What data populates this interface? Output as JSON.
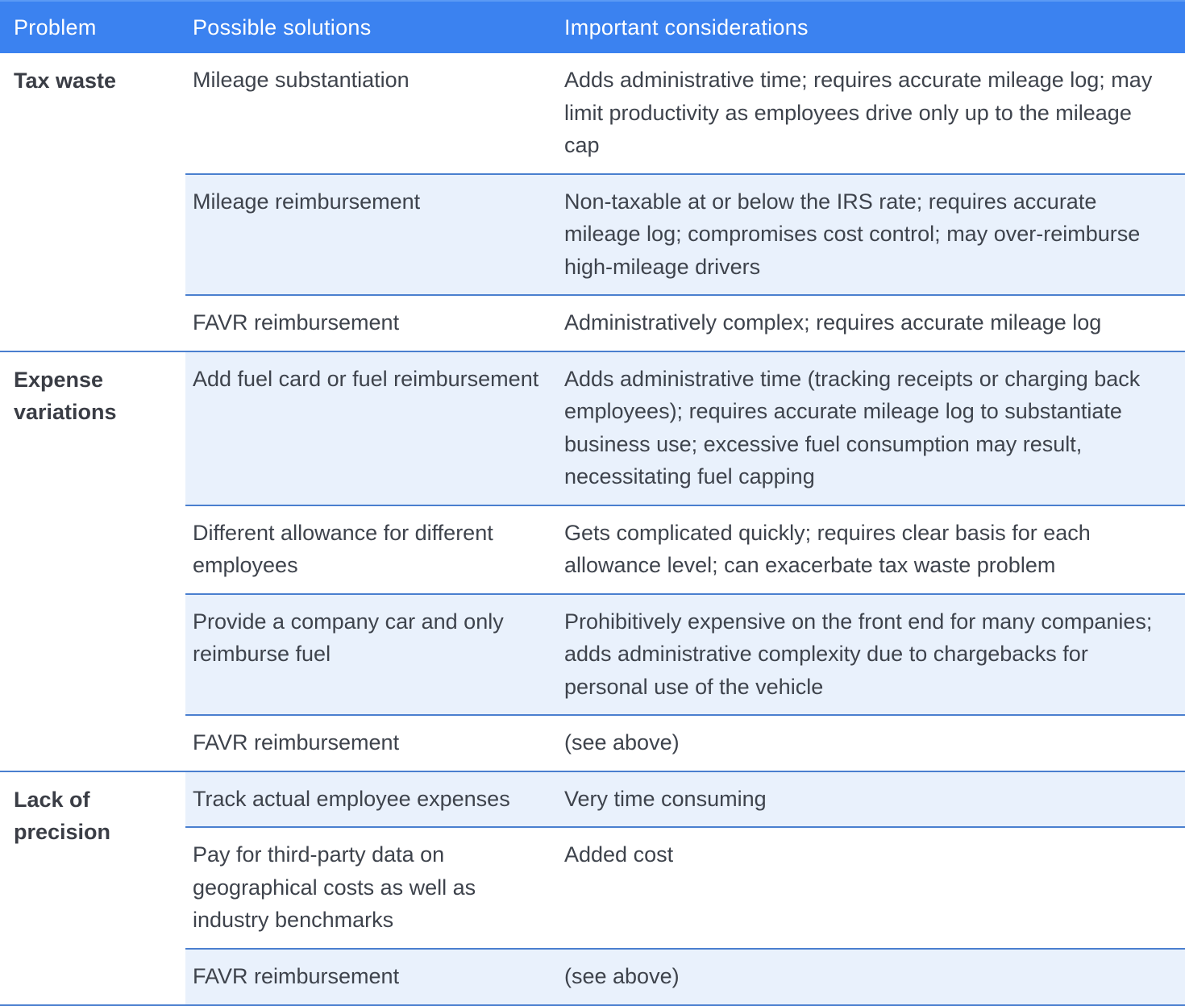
{
  "header": {
    "problem": "Problem",
    "solutions": "Possible solutions",
    "considerations": "Important considerations"
  },
  "colors": {
    "header_bg": "#3b82f0",
    "row_shade": "#e9f1fc",
    "divider": "#4a7fcf"
  },
  "groups": [
    {
      "problem": "Tax waste",
      "rows": [
        {
          "solution": "Mileage substantiation",
          "consideration": "Adds administrative time; requires accurate mileage log; may limit productivity as employees drive only up to the mileage cap"
        },
        {
          "solution": "Mileage reimbursement",
          "consideration": "Non-taxable at or below the IRS rate; requires accurate mileage log; compromises cost control; may over-reimburse high-mileage drivers"
        },
        {
          "solution": "FAVR reimbursement",
          "consideration": "Administratively complex; requires accurate mileage log"
        }
      ]
    },
    {
      "problem": "Expense variations",
      "rows": [
        {
          "solution": "Add fuel card or fuel reimbursement",
          "consideration": "Adds administrative time (tracking receipts or charging back employees); requires accurate mileage log to substantiate business use; excessive fuel consumption may result, necessitating fuel capping"
        },
        {
          "solution": "Different allowance for different employees",
          "consideration": "Gets complicated quickly; requires clear basis for each allowance level; can exacerbate tax waste problem"
        },
        {
          "solution": "Provide a company car and only reimburse fuel",
          "consideration": "Prohibitively expensive on the front end for many companies; adds administrative complexity due to chargebacks for personal use of the vehicle"
        },
        {
          "solution": "FAVR reimbursement",
          "consideration": "(see above)"
        }
      ]
    },
    {
      "problem": "Lack of precision",
      "rows": [
        {
          "solution": "Track actual employee expenses",
          "consideration": "Very time consuming"
        },
        {
          "solution": "Pay for third-party data on geographical costs as well as industry benchmarks",
          "consideration": "Added cost"
        },
        {
          "solution": "FAVR reimbursement",
          "consideration": "(see above)"
        }
      ]
    }
  ]
}
